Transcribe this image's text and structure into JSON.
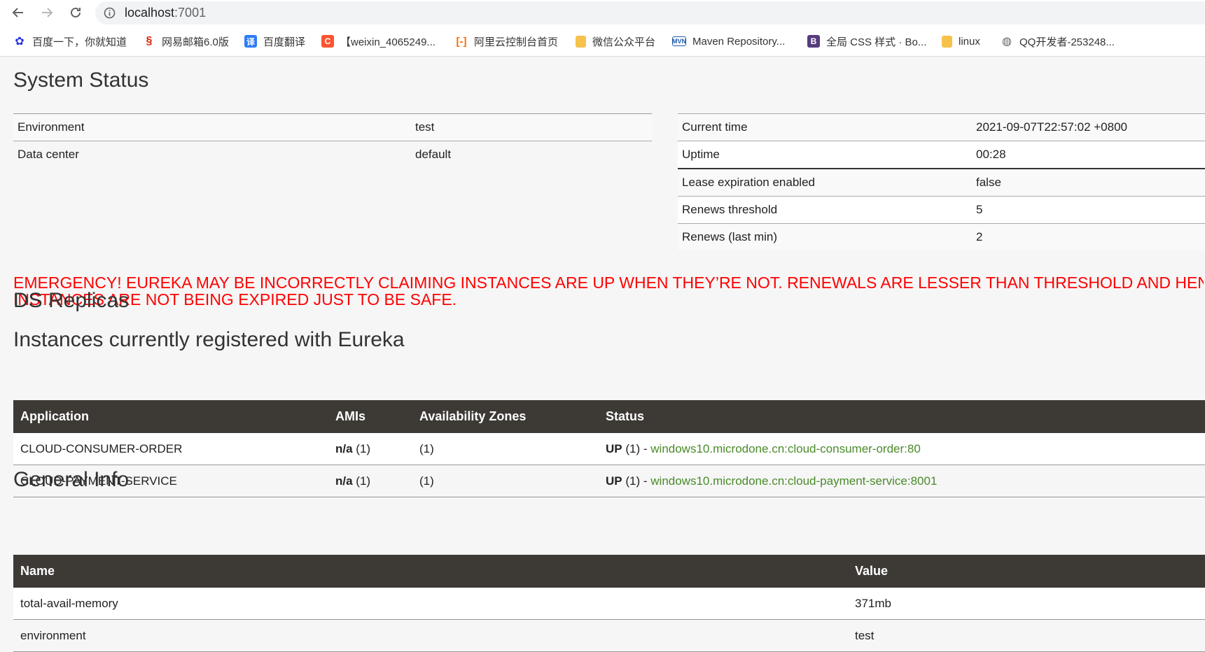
{
  "browser": {
    "url_host": "localhost",
    "url_port": ":7001",
    "bookmarks": [
      {
        "label": "百度一下，你就知道",
        "icon": "baidu-paw-icon",
        "color": "#2932e1"
      },
      {
        "label": "网易邮箱6.0版",
        "icon": "netease-mail-icon",
        "color": "#d81e06"
      },
      {
        "label": "百度翻译",
        "icon": "translate-icon",
        "color": "#2d7cf5"
      },
      {
        "label": "【weixin_4065249...",
        "icon": "csdn-c-icon",
        "color": "#fc5531"
      },
      {
        "label": "阿里云控制台首页",
        "icon": "aliyun-icon",
        "color": "#ff6a00"
      },
      {
        "label": "微信公众平台",
        "icon": "folder-icon",
        "color": "#f5c24c"
      },
      {
        "label": "Maven Repository...",
        "icon": "maven-icon",
        "color": "#1e5aa8"
      },
      {
        "label": "全局 CSS 样式 · Bo...",
        "icon": "bootstrap-b-icon",
        "color": "#563d7c"
      },
      {
        "label": "linux",
        "icon": "folder-icon",
        "color": "#f5c24c"
      },
      {
        "label": "QQ开发者-253248...",
        "icon": "globe-icon",
        "color": "#5f6368"
      }
    ]
  },
  "system_status": {
    "title": "System Status",
    "left": [
      {
        "key": "Environment",
        "value": "test"
      },
      {
        "key": "Data center",
        "value": "default"
      }
    ],
    "right": [
      {
        "key": "Current time",
        "value": "2021-09-07T22:57:02 +0800"
      },
      {
        "key": "Uptime",
        "value": "00:28"
      },
      {
        "key": "Lease expiration enabled",
        "value": "false"
      },
      {
        "key": "Renews threshold",
        "value": "5"
      },
      {
        "key": "Renews (last min)",
        "value": "2"
      }
    ]
  },
  "emergency": {
    "line1": "EMERGENCY! EUREKA MAY BE INCORRECTLY CLAIMING INSTANCES ARE UP WHEN THEY’RE NOT. RENEWALS ARE LESSER THAN THRESHOLD AND HENC",
    "line2": "INSTANCES ARE NOT BEING EXPIRED JUST TO BE SAFE.",
    "color": "#ff0000"
  },
  "ds_replicas": {
    "title": "DS Replicas"
  },
  "instances": {
    "title": "Instances currently registered with Eureka",
    "headers": [
      "Application",
      "AMIs",
      "Availability Zones",
      "Status"
    ],
    "rows": [
      {
        "application": "CLOUD-CONSUMER-ORDER",
        "amis_label": "n/a",
        "amis_count": "(1)",
        "zones": "(1)",
        "status_label": "UP",
        "status_count": "(1) -",
        "instance_link": "windows10.microdone.cn:cloud-consumer-order:80"
      },
      {
        "application": "CLOUD-PAYMENT-SERVICE",
        "amis_label": "n/a",
        "amis_count": "(1)",
        "zones": "(1)",
        "status_label": "UP",
        "status_count": "(1) -",
        "instance_link": "windows10.microdone.cn:cloud-payment-service:8001"
      }
    ],
    "link_color": "#4a8a2a"
  },
  "general_info": {
    "title": "General Info",
    "headers": [
      "Name",
      "Value"
    ],
    "rows": [
      {
        "name": "total-avail-memory",
        "value": "371mb"
      },
      {
        "name": "environment",
        "value": "test"
      }
    ]
  }
}
